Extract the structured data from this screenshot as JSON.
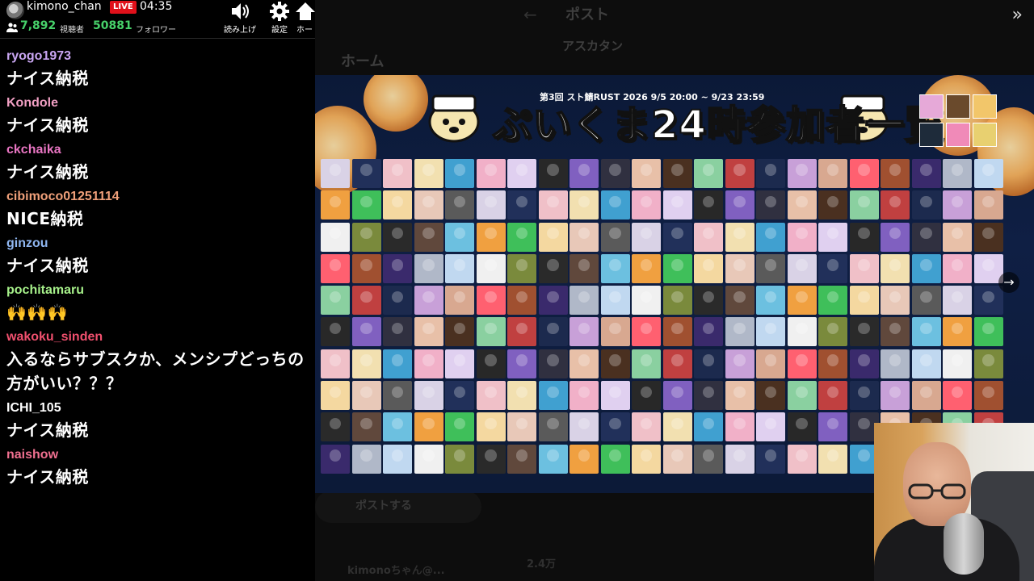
{
  "stream": {
    "channel_name": "kimono_chan",
    "live_badge": "LIVE",
    "elapsed_time": "04:35",
    "viewer_count": "7,892",
    "viewer_label": "視聴者",
    "follower_count": "50881",
    "follower_label": "フォロワー"
  },
  "header_buttons": [
    {
      "label": "読み上げ",
      "icon": "speaker-icon"
    },
    {
      "label": "設定",
      "icon": "gear-icon"
    },
    {
      "label": "ホー",
      "icon": "home-icon"
    }
  ],
  "chat_messages": [
    {
      "user": "ryogo1973",
      "text": "ナイス納税",
      "color": "#c9a6f2"
    },
    {
      "user": "Kondole",
      "text": "ナイス納税",
      "color": "#f2a0c4"
    },
    {
      "user": "ckchaika",
      "text": "ナイス納税",
      "color": "#e875c2"
    },
    {
      "user": "cibimoco01251114",
      "text": "NICE納税",
      "color": "#f0a07a"
    },
    {
      "user": "ginzou",
      "text": "ナイス納税",
      "color": "#8fb6f0"
    },
    {
      "user": "pochitamaru",
      "text": "🙌🙌🙌",
      "color": "#a6f08a"
    },
    {
      "user": "wakoku_sinden",
      "text": "入るならサブスクか、メンシプどっちの方がいい？？？",
      "color": "#f0506e"
    },
    {
      "user": "ICHI_105",
      "text": "ナイス納税",
      "color": "#ffffff"
    },
    {
      "user": "naishow",
      "text": "ナイス納税",
      "color": "#f07090"
    }
  ],
  "background_page": {
    "post_title": "ポスト",
    "home_label": "ホーム",
    "account_name": "アスカタン",
    "post_button": "ポストする",
    "bottom_text": "kimonoちゃん@...",
    "bottom_count": "2.4万"
  },
  "banner": {
    "title": "ぷいくま24時参加者一覧",
    "subtitle": "第3回 スト鯖RUST 2026 9/5 20:00 ~ 9/23 23:59"
  },
  "colors": {
    "live_red": "#e0101a",
    "count_green": "#47d16a",
    "banner_navy": "#0f1f44"
  }
}
